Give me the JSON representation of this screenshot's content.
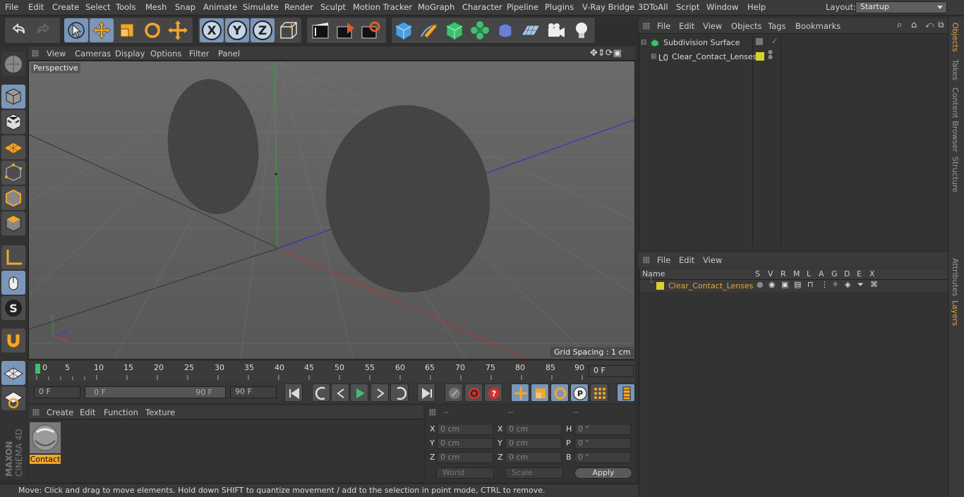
{
  "menubar": {
    "items": [
      "File",
      "Edit",
      "Create",
      "Select",
      "Tools",
      "Mesh",
      "Snap",
      "Animate",
      "Simulate",
      "Render",
      "Sculpt",
      "Motion Tracker",
      "MoGraph",
      "Character",
      "Pipeline",
      "Plugins",
      "V-Ray Bridge",
      "3DToAll",
      "Script",
      "Window",
      "Help"
    ],
    "layout_label": "Layout:",
    "layout_value": "Startup"
  },
  "toolbar": {
    "icons": [
      "undo-icon",
      "redo-icon",
      "live-selection-icon",
      "move-icon",
      "scale-icon",
      "rotate-icon",
      "transform-icon",
      "x-axis-icon",
      "y-axis-icon",
      "z-axis-icon",
      "coordinate-system-icon",
      "render-view-icon",
      "render-picture-viewer-icon",
      "render-settings-icon",
      "cube-icon",
      "pen-icon",
      "subdivision-icon",
      "mograph-cloner-icon",
      "deformer-icon",
      "floor-icon",
      "camera-icon",
      "light-icon"
    ]
  },
  "viewport": {
    "menu": [
      "View",
      "Cameras",
      "Display",
      "Options",
      "Filter",
      "Panel"
    ],
    "label": "Perspective",
    "grid_spacing": "Grid Spacing : 1 cm"
  },
  "timeline": {
    "ticks": [
      "0",
      "5",
      "10",
      "15",
      "20",
      "25",
      "30",
      "35",
      "40",
      "45",
      "50",
      "55",
      "60",
      "65",
      "70",
      "75",
      "80",
      "85",
      "90"
    ],
    "current_frame": "0 F"
  },
  "transport": {
    "start": "0 F",
    "range_start": "0 F",
    "range_end": "90 F",
    "end": "90 F"
  },
  "materials": {
    "menu": [
      "Create",
      "Edit",
      "Function",
      "Texture"
    ],
    "items": [
      {
        "name": "Contact"
      }
    ]
  },
  "coords": {
    "headers": [
      "--",
      "--",
      "--"
    ],
    "rows": [
      {
        "a": "X",
        "av": "0 cm",
        "b": "X",
        "bv": "0 cm",
        "c": "H",
        "cv": "0 °"
      },
      {
        "a": "Y",
        "av": "0 cm",
        "b": "Y",
        "bv": "0 cm",
        "c": "P",
        "cv": "0 °"
      },
      {
        "a": "Z",
        "av": "0 cm",
        "b": "Z",
        "bv": "0 cm",
        "c": "B",
        "cv": "0 °"
      }
    ],
    "world": "World",
    "scale": "Scale",
    "apply": "Apply"
  },
  "status": "Move: Click and drag to move elements. Hold down SHIFT to quantize movement / add to the selection in point mode, CTRL to remove.",
  "objects": {
    "menu": [
      "File",
      "Edit",
      "View",
      "Objects",
      "Tags",
      "Bookmarks"
    ],
    "items": [
      {
        "name": "Subdivision Surface"
      },
      {
        "name": "Clear_Contact_Lenses"
      }
    ]
  },
  "layers": {
    "menu": [
      "File",
      "Edit",
      "View"
    ],
    "columns": [
      "Name",
      "S",
      "V",
      "R",
      "M",
      "L",
      "A",
      "G",
      "D",
      "E",
      "X"
    ],
    "rows": [
      {
        "name": "Clear_Contact_Lenses"
      }
    ]
  },
  "side_tabs": [
    "Objects",
    "Takes",
    "Content Browser",
    "Structure",
    "Attributes",
    "Layers"
  ],
  "colors": {
    "accent": "#e8a33a",
    "selected": "#7a96b8",
    "layer_yellow": "#d9d22a"
  },
  "brand": "MAXON CINEMA 4D"
}
